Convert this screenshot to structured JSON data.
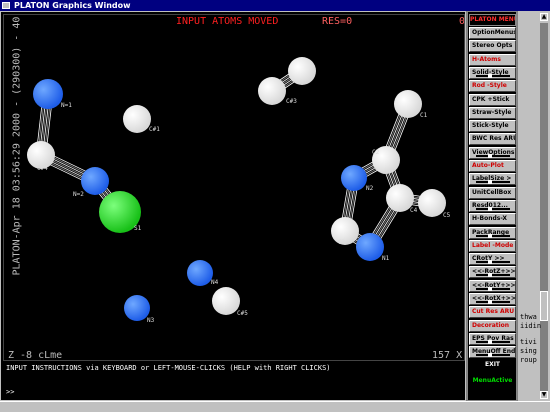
{
  "window": {
    "title": "PLATON Graphics Window"
  },
  "canvas": {
    "banner": "INPUT ATOMS MOVED",
    "res": "RES=0",
    "corner_value": "0",
    "side_text": "PLATON-Apr 18 03:56:29 2000 - (290300) - 40 Y",
    "bottom_left": "Z -8    cLme",
    "bottom_right": "157 X"
  },
  "atoms": [
    {
      "label": "N=1",
      "color": "#3a7bff"
    },
    {
      "label": "C#4",
      "color": "#ffffff"
    },
    {
      "label": "N=2",
      "color": "#3a7bff"
    },
    {
      "label": "S1",
      "color": "#33dd33"
    },
    {
      "label": "C#1",
      "color": "#ffffff"
    },
    {
      "label": "C#3",
      "color": "#ffffff"
    },
    {
      "label": "C1",
      "color": "#ffffff"
    },
    {
      "label": "C2",
      "color": "#ffffff"
    },
    {
      "label": "N2",
      "color": "#3a7bff"
    },
    {
      "label": "C4",
      "color": "#ffffff"
    },
    {
      "label": "C5",
      "color": "#ffffff"
    },
    {
      "label": "C3",
      "color": "#ffffff"
    },
    {
      "label": "N1",
      "color": "#3a7bff"
    },
    {
      "label": "N4",
      "color": "#3a7bff"
    },
    {
      "label": "N3",
      "color": "#3a7bff"
    },
    {
      "label": "C#5",
      "color": "#ffffff"
    }
  ],
  "instructions": {
    "line": "INPUT INSTRUCTIONS via KEYBOARD or LEFT-MOUSE-CLICKS (HELP with RIGHT CLICKS)",
    "prompt": ">>"
  },
  "menu": {
    "title": "PLATON MENU",
    "items": [
      {
        "label": "OptionMenus",
        "red": false,
        "slider": false
      },
      {
        "label": "Stereo Opts",
        "red": false,
        "slider": false
      },
      {
        "label": "H-Atoms",
        "red": true,
        "slider": false
      },
      {
        "label": "Solid-Style",
        "red": false,
        "slider": true
      },
      {
        "label": "Rod -Style",
        "red": true,
        "slider": false
      },
      {
        "label": "CPK +Stick",
        "red": false,
        "slider": false
      },
      {
        "label": "Straw-Style",
        "red": false,
        "slider": false
      },
      {
        "label": "Stick-Style",
        "red": false,
        "slider": false
      },
      {
        "label": "BWC Res ARU",
        "red": false,
        "slider": false
      },
      {
        "label": "ViewOptions",
        "red": false,
        "slider": true
      },
      {
        "label": "Auto-Plot",
        "red": true,
        "slider": false
      },
      {
        "label": "LabelSize >",
        "red": false,
        "slider": true
      },
      {
        "label": "UnitCellBox",
        "red": false,
        "slider": false
      },
      {
        "label": "Resd012...",
        "red": false,
        "slider": true
      },
      {
        "label": "H-Bonds-X",
        "red": false,
        "slider": false
      },
      {
        "label": "PackRange",
        "red": false,
        "slider": true
      },
      {
        "label": "Label -Mode",
        "red": true,
        "slider": false
      },
      {
        "label": "CRotY >>",
        "red": false,
        "slider": true
      },
      {
        "label": "<<-RotZ+>>",
        "red": false,
        "slider": true
      },
      {
        "label": "<<-RotY+>>",
        "red": false,
        "slider": true
      },
      {
        "label": "<<-RotX+>>",
        "red": false,
        "slider": true
      },
      {
        "label": "Cut Res ARU",
        "red": true,
        "slider": false
      },
      {
        "label": "Decoration",
        "red": true,
        "slider": false
      },
      {
        "label": "EPS Pov Ras",
        "red": false,
        "slider": true
      },
      {
        "label": "MenuOff End",
        "red": false,
        "slider": true
      }
    ],
    "exit": "EXIT",
    "status": "MenuActive"
  },
  "background_text": [
    "thwa",
    "iidin",
    "tivi",
    "sing",
    "roup"
  ]
}
